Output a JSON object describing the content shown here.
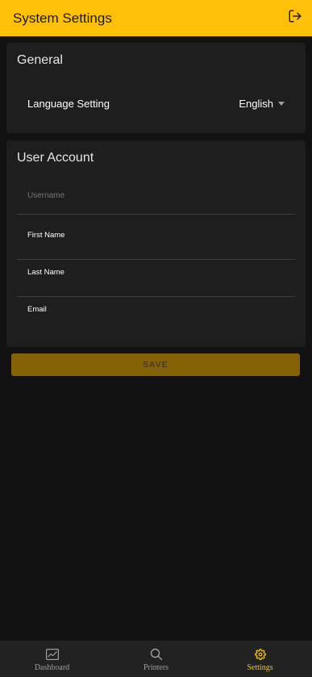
{
  "header": {
    "title": "System Settings",
    "logout_icon": "logout-icon"
  },
  "general": {
    "title": "General",
    "language_label": "Language Setting",
    "language_value": "English"
  },
  "account": {
    "title": "User Account",
    "username_placeholder": "Username",
    "username_value": "",
    "first_name_label": "First Name",
    "first_name_value": "",
    "last_name_label": "Last Name",
    "last_name_value": "",
    "email_label": "Email",
    "email_value": ""
  },
  "save_label": "SAVE",
  "bottom_nav": {
    "items": [
      {
        "label": "Dashboard",
        "icon": "chart-icon",
        "active": false
      },
      {
        "label": "Printers",
        "icon": "search-icon",
        "active": false
      },
      {
        "label": "Settings",
        "icon": "gear-icon",
        "active": true
      }
    ]
  },
  "colors": {
    "accent": "#ffc107",
    "save_button": "#866207",
    "background": "#121212",
    "card": "#1e1e1e",
    "nav_background": "#222222",
    "nav_inactive": "#9e9e9e"
  }
}
